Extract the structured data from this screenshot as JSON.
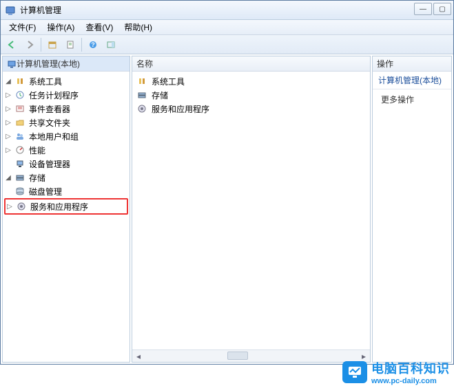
{
  "window": {
    "title": "计算机管理"
  },
  "menu": {
    "file": "文件(F)",
    "action": "操作(A)",
    "view": "查看(V)",
    "help": "帮助(H)"
  },
  "toolbar_icons": {
    "back": "back-arrow-icon",
    "forward": "forward-arrow-icon",
    "up": "up-folder-icon",
    "properties": "properties-icon",
    "refresh": "refresh-icon",
    "help": "help-icon",
    "show": "show-panel-icon"
  },
  "tree": {
    "root_label": "计算机管理(本地)",
    "system_tools": {
      "label": "系统工具",
      "children": [
        {
          "label": "任务计划程序",
          "icon": "task-scheduler-icon"
        },
        {
          "label": "事件查看器",
          "icon": "event-viewer-icon"
        },
        {
          "label": "共享文件夹",
          "icon": "shared-folders-icon"
        },
        {
          "label": "本地用户和组",
          "icon": "users-groups-icon"
        },
        {
          "label": "性能",
          "icon": "performance-icon"
        },
        {
          "label": "设备管理器",
          "icon": "device-manager-icon"
        }
      ]
    },
    "storage": {
      "label": "存储",
      "children": [
        {
          "label": "磁盘管理",
          "icon": "disk-mgmt-icon"
        }
      ]
    },
    "services_apps": {
      "label": "服务和应用程序",
      "icon": "services-apps-icon"
    }
  },
  "mid": {
    "header": "名称",
    "items": [
      {
        "label": "系统工具",
        "icon": "system-tools-icon"
      },
      {
        "label": "存储",
        "icon": "storage-icon"
      },
      {
        "label": "服务和应用程序",
        "icon": "services-apps-icon"
      }
    ]
  },
  "right": {
    "header": "操作",
    "group": "计算机管理(本地)",
    "more": "更多操作"
  },
  "watermark": {
    "cn": "电脑百科知识",
    "url": "www.pc-daily.com"
  }
}
